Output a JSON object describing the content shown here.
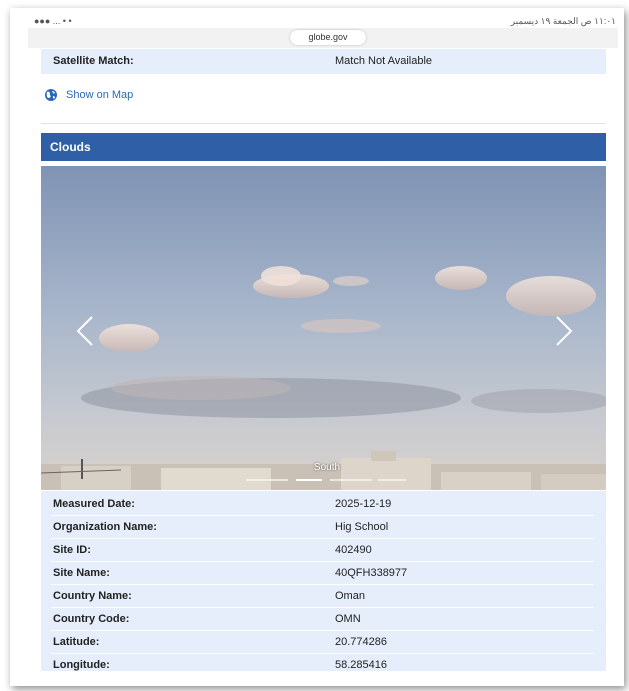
{
  "browser": {
    "status_left": "●●● ... • •",
    "status_right": "۱۱:۰۱ ص الجمعة ۱۹ ديسمبر",
    "url": "globe.gov"
  },
  "satellite": {
    "label": "Satellite Match:",
    "value": "Match Not Available"
  },
  "map_link": {
    "label": "Show on Map",
    "icon": "globe-icon"
  },
  "clouds": {
    "header": "Clouds",
    "photo_caption": "South",
    "prev_icon": "chevron-left-icon",
    "next_icon": "chevron-right-icon"
  },
  "details": [
    {
      "label": "Measured Date:",
      "value": "2025-12-19"
    },
    {
      "label": "Organization Name:",
      "value": "Hig School"
    },
    {
      "label": "Site ID:",
      "value": "402490"
    },
    {
      "label": "Site Name:",
      "value": "40QFH338977"
    },
    {
      "label": "Country Name:",
      "value": "Oman"
    },
    {
      "label": "Country Code:",
      "value": "OMN"
    },
    {
      "label": "Latitude:",
      "value": "20.774286"
    },
    {
      "label": "Longitude:",
      "value": "58.285416"
    }
  ],
  "colors": {
    "header_bg": "#2f5fa6",
    "row_bg": "#e6eefb",
    "link": "#2a68b8"
  }
}
